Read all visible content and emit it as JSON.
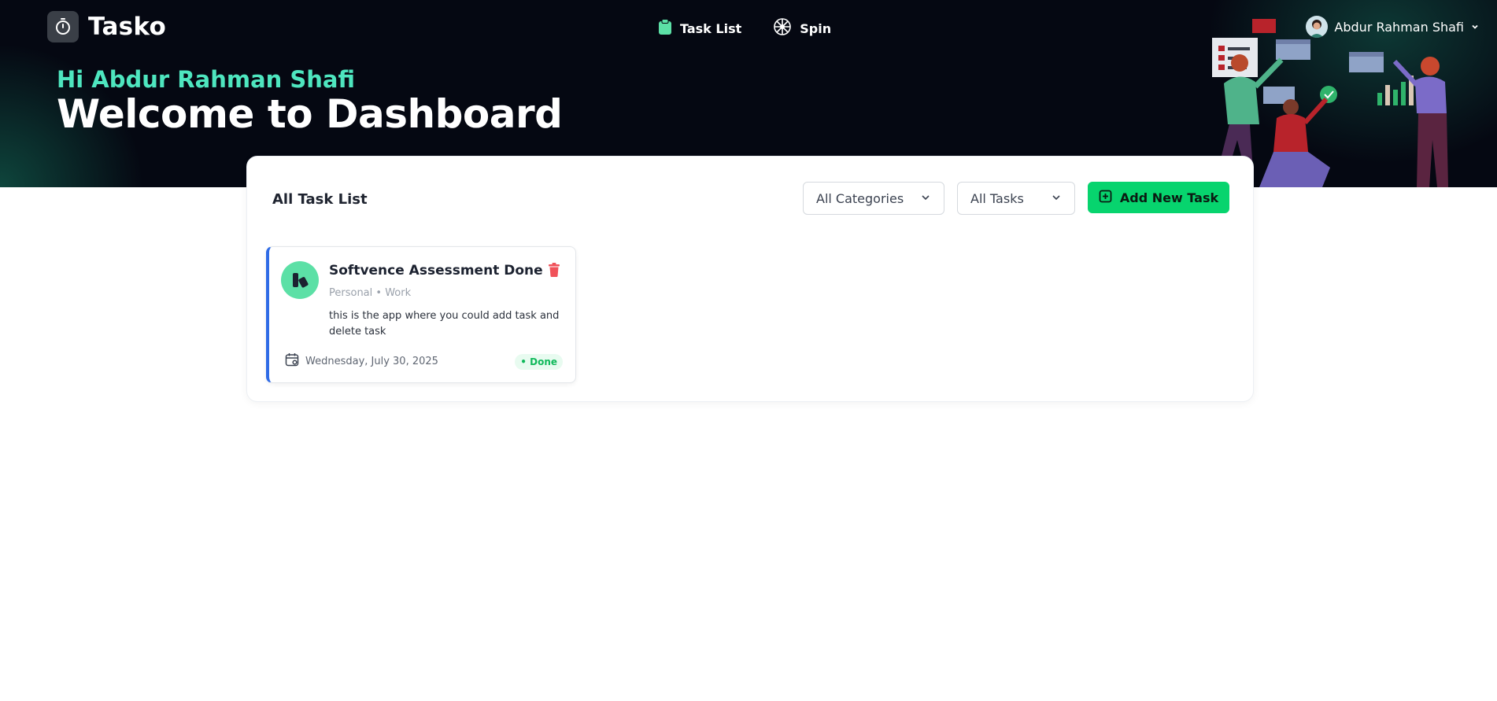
{
  "app": {
    "name": "Tasko"
  },
  "nav": {
    "items": [
      {
        "label": "Task List",
        "icon": "clipboard-icon"
      },
      {
        "label": "Spin",
        "icon": "wheel-icon"
      }
    ]
  },
  "user": {
    "name": "Abdur Rahman Shafi"
  },
  "hero": {
    "greeting": "Hi Abdur Rahman Shafi",
    "title": "Welcome to Dashboard"
  },
  "panel": {
    "title": "All Task List",
    "category_filter": "All Categories",
    "status_filter": "All Tasks",
    "add_button": "Add New Task"
  },
  "tasks": [
    {
      "title": "Softvence Assessment Done",
      "categories": "Personal • Work",
      "description": "this is the app where you could add task and delete task",
      "date": "Wednesday, July 30, 2025",
      "status": "• Done"
    }
  ],
  "colors": {
    "accent": "#07d46e",
    "greeting": "#4ee6bf",
    "task_border": "#2f6be6",
    "delete": "#f0525a"
  }
}
